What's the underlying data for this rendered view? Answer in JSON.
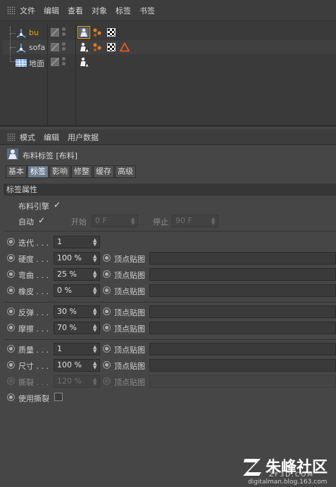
{
  "object_manager": {
    "menu": [
      "文件",
      "编辑",
      "查看",
      "对象",
      "标签",
      "书签"
    ],
    "objects": [
      {
        "name": "bu",
        "active": true
      },
      {
        "name": "sofa",
        "active": false
      },
      {
        "name": "地面",
        "active": false
      }
    ]
  },
  "attribute_manager": {
    "menu": [
      "模式",
      "编辑",
      "用户数据"
    ],
    "title": "布料标签 [布料]",
    "tabs": [
      "基本",
      "标签",
      "影响",
      "修整",
      "缓存",
      "高级"
    ],
    "active_tab": "标签",
    "section": "标签属性",
    "cloth_engine_label": "布料引擎",
    "auto_label": "自动",
    "start_label": "开始",
    "start_value": "0 F",
    "stop_label": "停止",
    "stop_value": "90 F",
    "vertex_map_label": "顶点贴图",
    "params": {
      "iterations": {
        "label": "迭代 . . .",
        "value": "1"
      },
      "stiffness": {
        "label": "硬度 . . .",
        "value": "100 %"
      },
      "bend": {
        "label": "弯曲 . . .",
        "value": "25 %"
      },
      "rubber": {
        "label": "橡皮 . . .",
        "value": "0 %"
      },
      "bounce": {
        "label": "反弹 . . .",
        "value": "30 %"
      },
      "friction": {
        "label": "摩擦 . . .",
        "value": "70 %"
      },
      "mass": {
        "label": "质量 . . .",
        "value": "1"
      },
      "size": {
        "label": "尺寸 . . .",
        "value": "100 %"
      },
      "tear": {
        "label": "撕裂 . . .",
        "value": "120 %"
      },
      "use_tear": {
        "label": "使用撕裂"
      }
    }
  },
  "watermark": {
    "logo": "朱峰社区",
    "z": "Z",
    "sub": "ZF3D.COM",
    "url": "digitalman.blog.163.com"
  }
}
